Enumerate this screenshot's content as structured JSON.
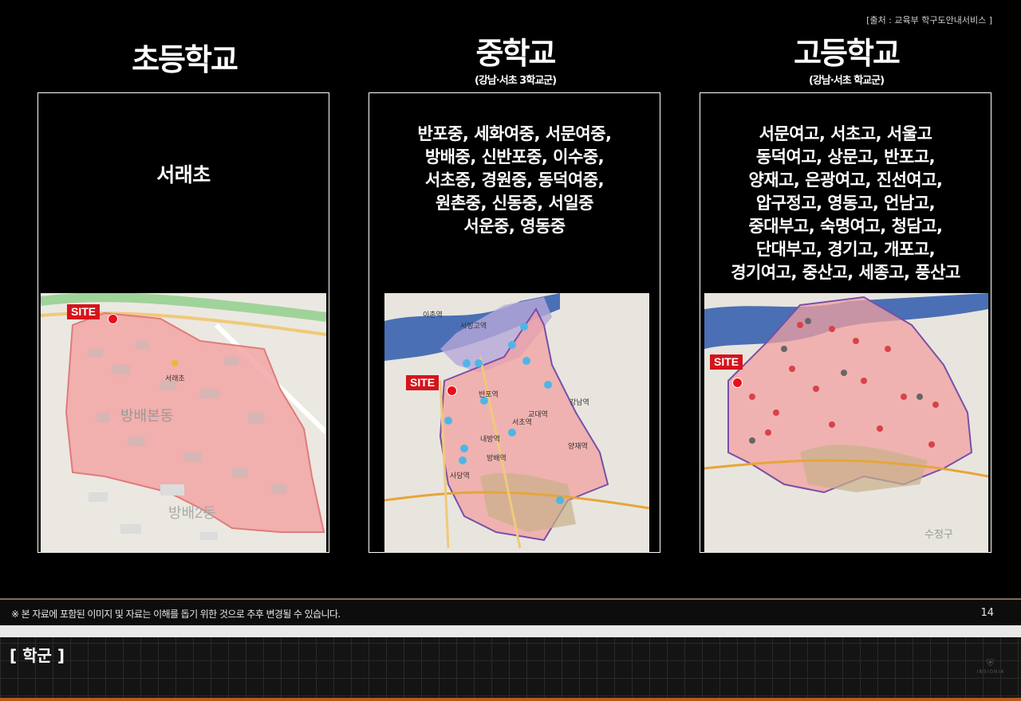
{
  "source": "[출처 : 교육부 학구도안내서비스 ]",
  "columns": [
    {
      "title": "초등학교",
      "subtitle": "",
      "schools": [
        "서래초"
      ]
    },
    {
      "title": "중학교",
      "subtitle": "(강남·서초 3학교군)",
      "schools": [
        "반포중, 세화여중, 서문여중,",
        "방배중, 신반포중, 이수중,",
        "서초중, 경원중, 동덕여중,",
        "원촌중, 신동중, 서일중",
        "서운중, 영동중"
      ]
    },
    {
      "title": "고등학교",
      "subtitle": "(강남·서초 학교군)",
      "schools": [
        "서문여고, 서초고, 서울고",
        "동덕여고, 상문고, 반포고,",
        "양재고, 은광여고, 진선여고,",
        "압구정고, 영동고, 언남고,",
        "중대부고, 숙명여고, 청담고,",
        "단대부고, 경기고, 개포고,",
        "경기여고, 중산고, 세종고, 풍산고"
      ]
    }
  ],
  "site_label": "SITE",
  "map_labels": {
    "m1": [
      "방배본동",
      "방배2동",
      "서래초"
    ],
    "m2": [
      "이촌역",
      "서빙고역",
      "반포역",
      "강남역",
      "양재역",
      "서초역",
      "교대역",
      "방배역",
      "사당역",
      "내방역"
    ],
    "m3": [
      "수정구"
    ]
  },
  "footer": {
    "disclaimer": "※ 본 자료에 포함된 이미지 및 자료는 이해를 돕기 위한 것으로 추후 변경될 수 있습니다.",
    "page": "14"
  },
  "section_title": "[ 학군 ]",
  "brand": "INSIGNIA",
  "colors": {
    "accent": "#d5141b",
    "zone": "#f2a0a0",
    "divider": "#8a6a52"
  }
}
